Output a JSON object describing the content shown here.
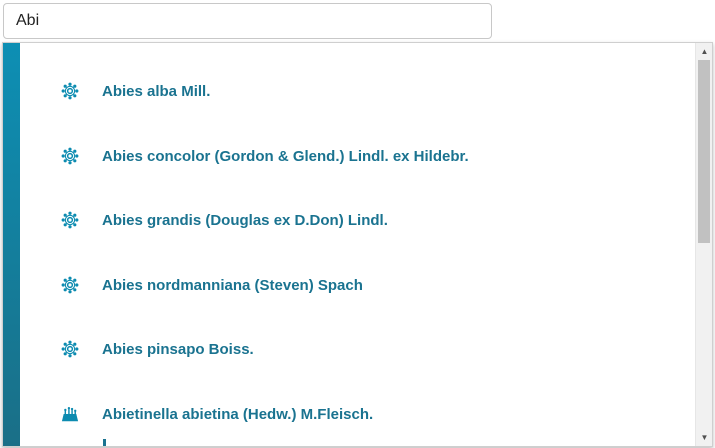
{
  "search": {
    "value": "Abi",
    "placeholder": ""
  },
  "results": [
    {
      "label": "Abies alba Mill.",
      "icon": "flower-icon"
    },
    {
      "label": "Abies concolor (Gordon & Glend.) Lindl. ex Hildebr.",
      "icon": "flower-icon"
    },
    {
      "label": "Abies grandis (Douglas ex D.Don) Lindl.",
      "icon": "flower-icon"
    },
    {
      "label": "Abies nordmanniana (Steven) Spach",
      "icon": "flower-icon"
    },
    {
      "label": "Abies pinsapo Boiss.",
      "icon": "flower-icon"
    },
    {
      "label": "Abietinella abietina (Hedw.) M.Fleisch.",
      "icon": "moss-icon"
    }
  ],
  "colors": {
    "accent": "#1a7390",
    "accent_bar_top": "#0d8fb4",
    "accent_bar_bottom": "#1a6f87",
    "scroll_thumb": "#c1c1c1"
  },
  "scrollbar": {
    "position_fraction": 0.0,
    "visible_fraction": 0.48
  }
}
